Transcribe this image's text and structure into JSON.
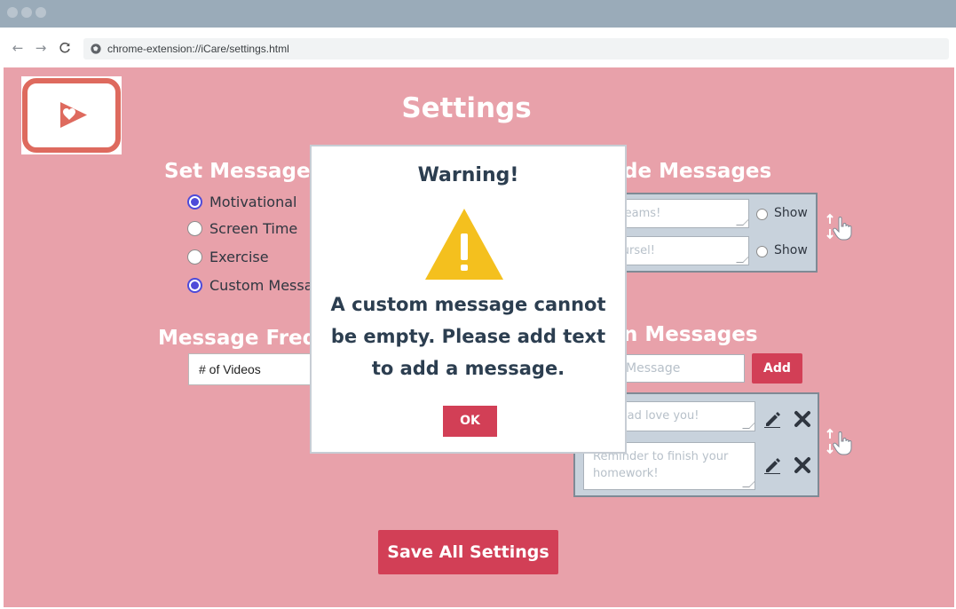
{
  "browser": {
    "url": "chrome-extension://iCare/settings.html"
  },
  "page": {
    "title": "Settings"
  },
  "set_messages": {
    "heading": "Set Messages",
    "options": [
      {
        "label": "Motivational",
        "checked": true
      },
      {
        "label": "Screen Time",
        "checked": false
      },
      {
        "label": "Exercise",
        "checked": false
      },
      {
        "label": "Custom Messa",
        "checked": true
      }
    ]
  },
  "frequency": {
    "heading": "Message Freq",
    "selected": "# of Videos"
  },
  "prebuilt": {
    "heading": "de Messages",
    "items": [
      {
        "text": "your dreams!",
        "show_label": "Show"
      },
      {
        "text": "e in yoursel!",
        "show_label": "Show"
      }
    ]
  },
  "custom": {
    "heading": "n Messages",
    "input_placeholder": "Message",
    "add_label": "Add",
    "items": [
      {
        "text": "and Dad love you!"
      },
      {
        "text": "Reminder to finish your homework!"
      }
    ]
  },
  "save_label": "Save All Settings",
  "modal": {
    "title": "Warning!",
    "message": "A custom message cannot be empty. Please add text to add a message.",
    "ok_label": "OK"
  },
  "colors": {
    "page_bg": "#e8a1aa",
    "accent": "#d23f56",
    "panel_bg": "#c8d2dc",
    "warning": "#f4c01e",
    "text_dark": "#2c3e50"
  },
  "icons": [
    "back-icon",
    "forward-icon",
    "reload-icon",
    "site-info-icon",
    "warning-icon",
    "edit-icon",
    "delete-icon",
    "drag-hand-icon",
    "app-logo"
  ]
}
